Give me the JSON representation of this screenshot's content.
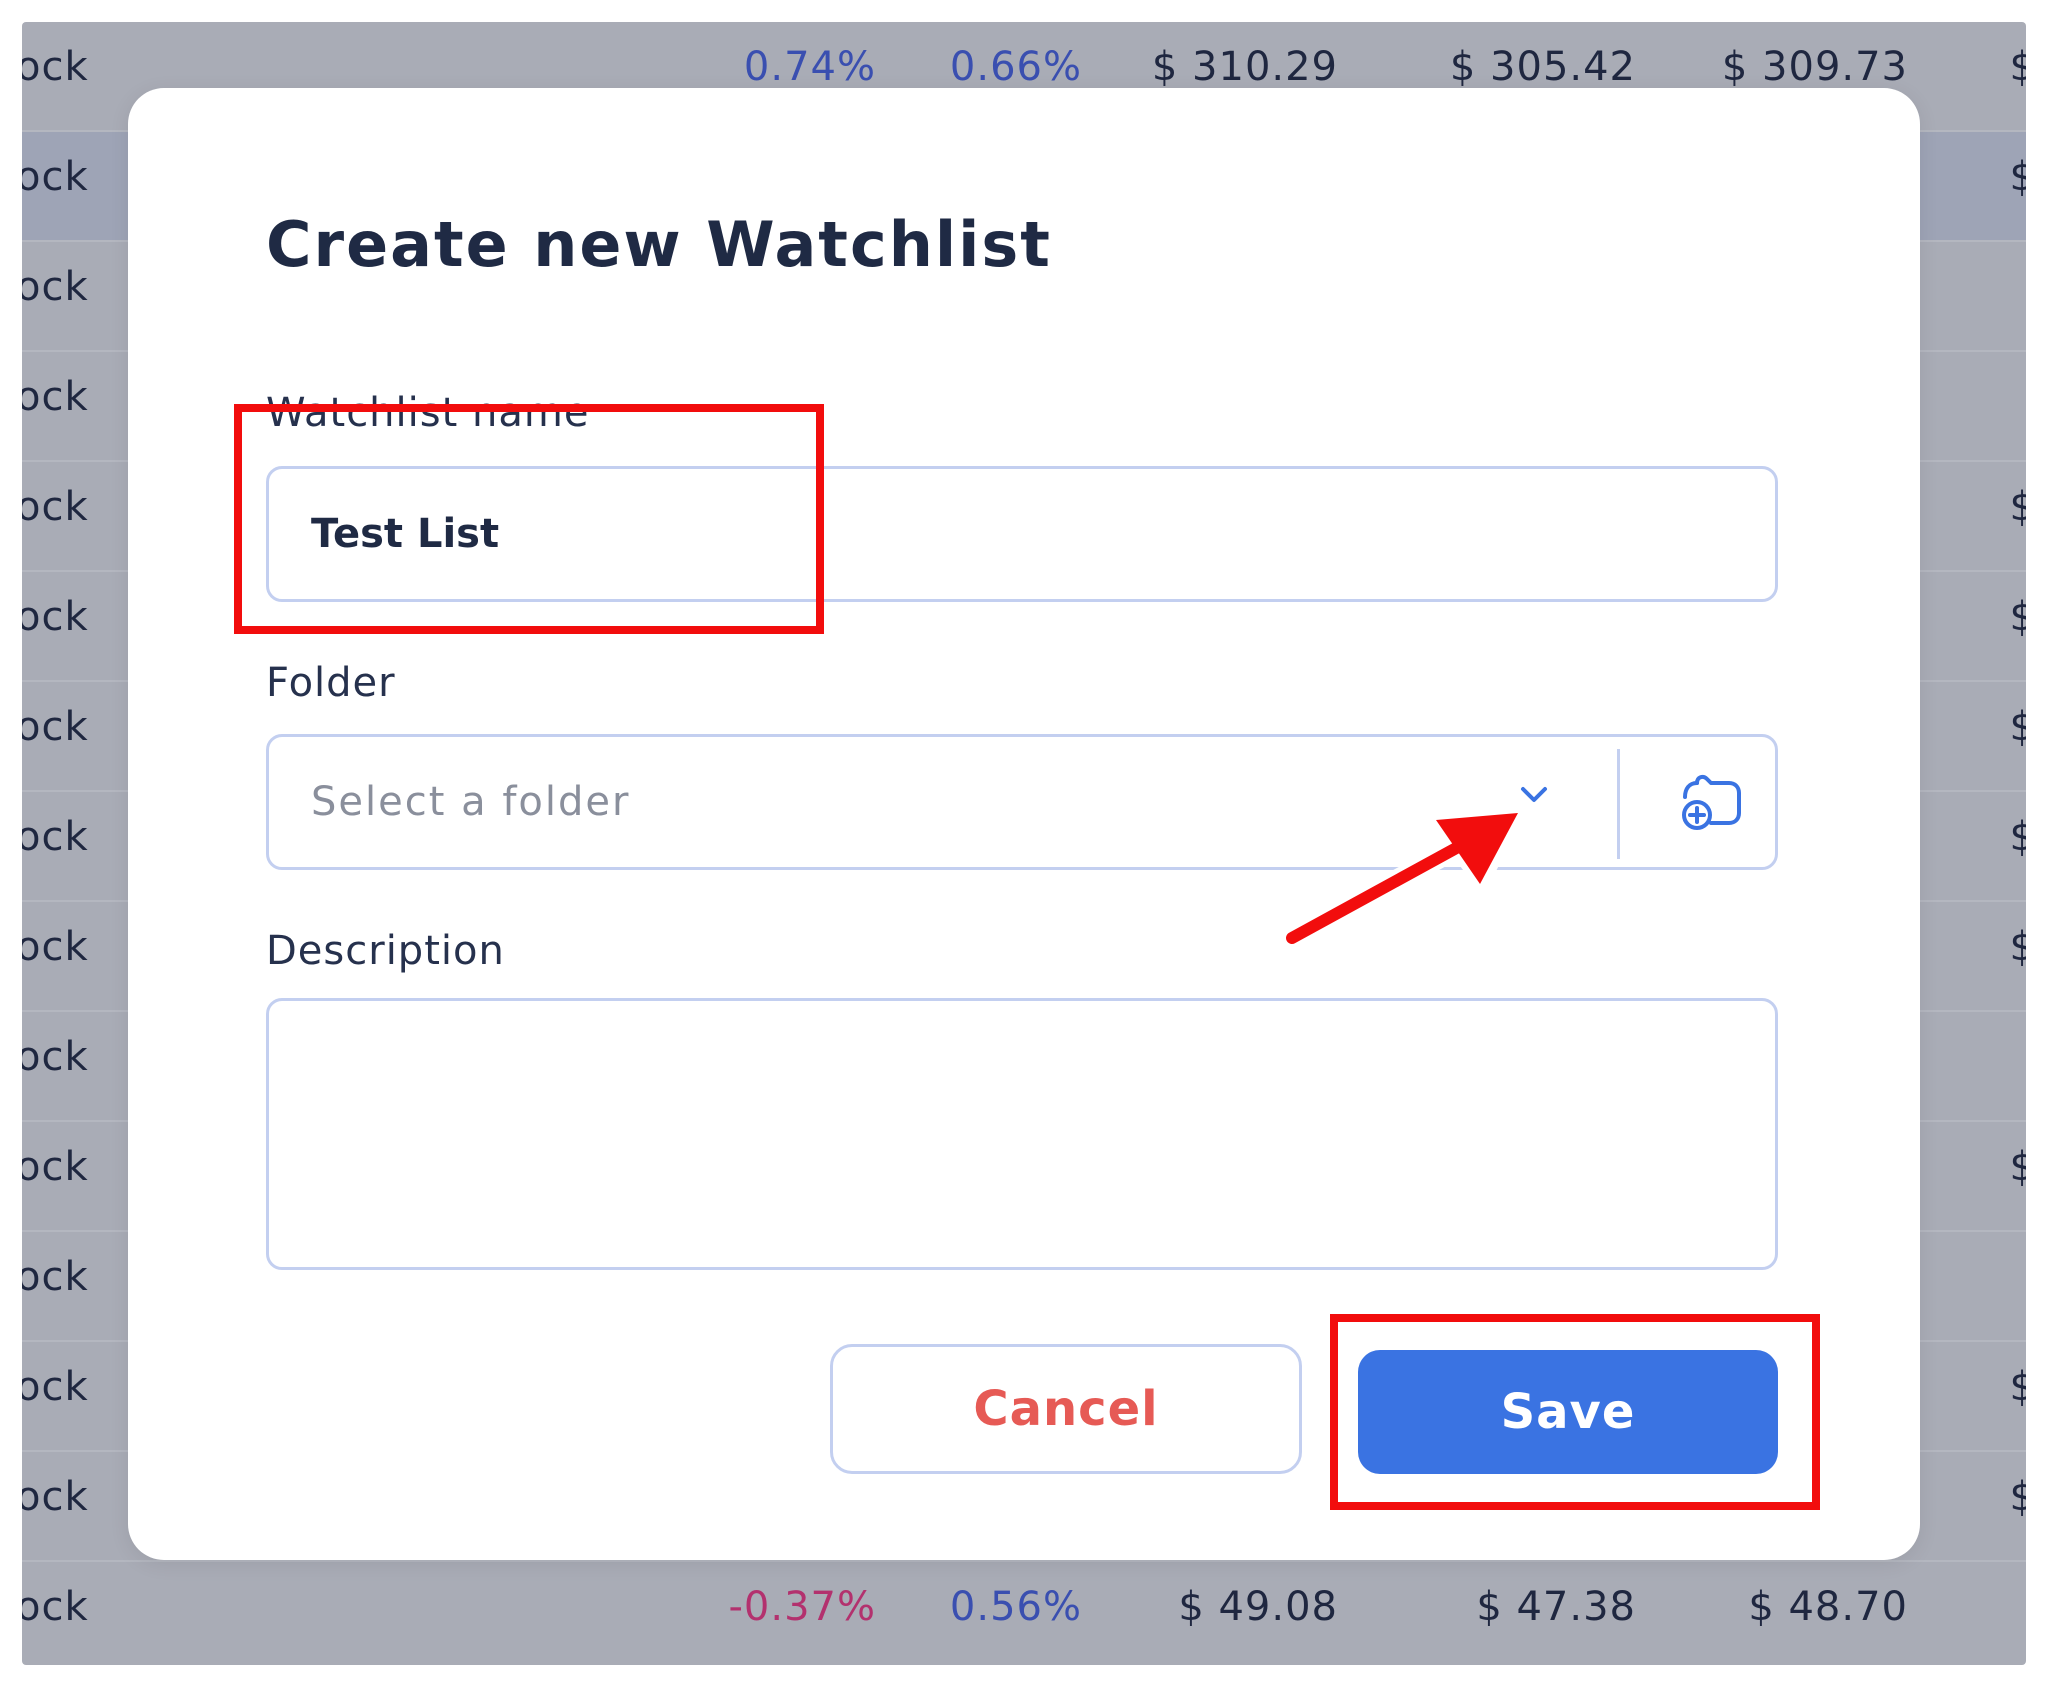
{
  "background_table": {
    "rows": [
      {
        "type": "ock",
        "pct1": "0.74%",
        "pct2": "0.66%",
        "p1": "$ 310.29",
        "p2": "$ 305.42",
        "p3": "$ 309.73",
        "p4": "$"
      },
      {
        "type": "ock",
        "pct1": "",
        "pct2": "",
        "p1": "",
        "p2": "",
        "p3": "",
        "p4": "$"
      },
      {
        "type": "ock",
        "pct1": "",
        "pct2": "",
        "p1": "",
        "p2": "",
        "p3": "",
        "p4": ""
      },
      {
        "type": "ock",
        "pct1": "",
        "pct2": "",
        "p1": "",
        "p2": "",
        "p3": "",
        "p4": ""
      },
      {
        "type": "ock",
        "pct1": "",
        "pct2": "",
        "p1": "",
        "p2": "",
        "p3": "",
        "p4": "$"
      },
      {
        "type": "ock",
        "pct1": "",
        "pct2": "",
        "p1": "",
        "p2": "",
        "p3": "",
        "p4": "$"
      },
      {
        "type": "ock",
        "pct1": "",
        "pct2": "",
        "p1": "",
        "p2": "",
        "p3": "",
        "p4": "$"
      },
      {
        "type": "ock",
        "pct1": "",
        "pct2": "",
        "p1": "",
        "p2": "",
        "p3": "",
        "p4": "$"
      },
      {
        "type": "ock",
        "pct1": "",
        "pct2": "",
        "p1": "",
        "p2": "",
        "p3": "",
        "p4": "$"
      },
      {
        "type": "ock",
        "pct1": "",
        "pct2": "",
        "p1": "",
        "p2": "",
        "p3": "",
        "p4": ""
      },
      {
        "type": "ock",
        "pct1": "",
        "pct2": "",
        "p1": "",
        "p2": "",
        "p3": "",
        "p4": "$"
      },
      {
        "type": "ock",
        "pct1": "",
        "pct2": "",
        "p1": "",
        "p2": "",
        "p3": "",
        "p4": ""
      },
      {
        "type": "ock",
        "pct1": "",
        "pct2": "",
        "p1": "",
        "p2": "",
        "p3": "",
        "p4": "$"
      },
      {
        "type": "ock",
        "pct1": "",
        "pct2": "",
        "p1": "",
        "p2": "",
        "p3": "",
        "p4": "$"
      },
      {
        "type": "ock",
        "pct1": "-0.37%",
        "pct2": "0.56%",
        "p1": "$ 49.08",
        "p2": "$ 47.38",
        "p3": "$ 48.70",
        "p4": ""
      }
    ]
  },
  "modal": {
    "title": "Create new Watchlist",
    "name_label": "Watchlist name",
    "name_value": "Test List",
    "folder_label": "Folder",
    "folder_placeholder": "Select a folder",
    "description_label": "Description",
    "description_value": "",
    "cancel_label": "Cancel",
    "save_label": "Save"
  },
  "icons": {
    "chevron": "chevron-down-icon",
    "folder_add": "folder-add-icon"
  },
  "colors": {
    "accent": "#3a73e2",
    "cancel_text": "#e65a55",
    "annotation": "#f20d0d",
    "positive": "#3a4fb0",
    "negative": "#b3316e"
  }
}
